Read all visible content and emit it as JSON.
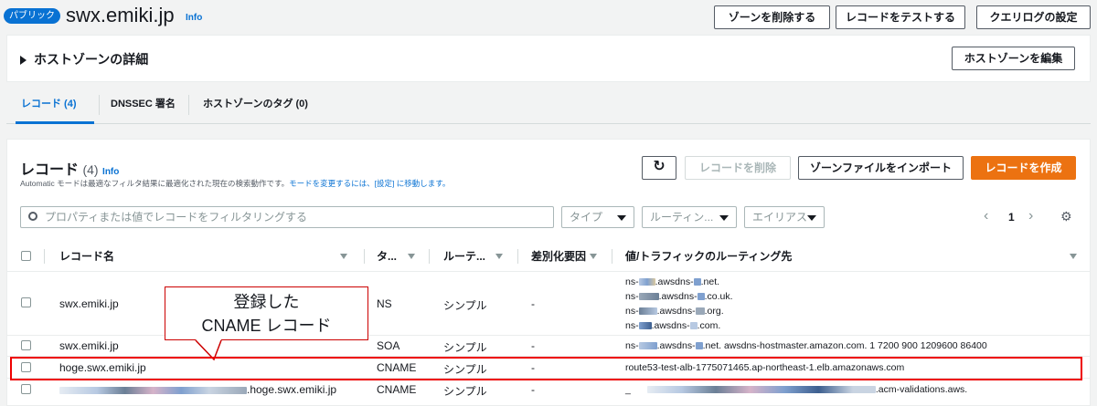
{
  "header": {
    "badge": "パブリック",
    "title": "swx.emiki.jp",
    "info": "Info",
    "buttons": {
      "delete_zone": "ゾーンを削除する",
      "test_record": "レコードをテストする",
      "query_log": "クエリログの設定"
    }
  },
  "details_panel": {
    "title": "ホストゾーンの詳細",
    "edit_button": "ホストゾーンを編集"
  },
  "tabs": [
    {
      "label": "レコード (4)"
    },
    {
      "label": "DNSSEC 署名"
    },
    {
      "label": "ホストゾーンのタグ (0)"
    }
  ],
  "records": {
    "title": "レコード",
    "count": "(4)",
    "info": "Info",
    "desc_text": "Automatic モードは最適なフィルタ結果に最適化された現在の検索動作です。",
    "desc_link": "モードを変更するには、[設定] に移動します。",
    "buttons": {
      "delete": "レコードを削除",
      "import": "ゾーンファイルをインポート",
      "create": "レコードを作成"
    },
    "search_placeholder": "プロパティまたは値でレコードをフィルタリングする",
    "filters": {
      "type": "タイプ",
      "routing": "ルーティン...",
      "alias": "エイリアス"
    },
    "page": "1"
  },
  "table": {
    "headers": {
      "name": "レコード名",
      "type": "タ...",
      "routing": "ルーテ...",
      "diff": "差別化要因",
      "value": "値/トラフィックのルーティング先"
    },
    "rows": [
      {
        "name": "swx.emiki.jp",
        "type": "NS",
        "routing": "シンプル",
        "diff": "-",
        "values": [
          "ns-",
          ".awsdns-",
          ".net.",
          "ns-",
          ".awsdns-",
          ".co.uk.",
          "ns-",
          ".awsdns-",
          ".org.",
          "ns-",
          ".awsdns-",
          ".com."
        ]
      },
      {
        "name": "swx.emiki.jp",
        "type": "SOA",
        "routing": "シンプル",
        "diff": "-",
        "value_prefix": "ns-",
        "value_mid": ".awsdns-",
        "value_rest": ".net. awsdns-hostmaster.amazon.com. 1 7200 900 1209600 86400"
      },
      {
        "name": "hoge.swx.emiki.jp",
        "type": "CNAME",
        "routing": "シンプル",
        "diff": "-",
        "value": "route53-test-alb-1775071465.ap-northeast-1.elb.amazonaws.com"
      },
      {
        "name_suffix": ".hoge.swx.emiki.jp",
        "type": "CNAME",
        "routing": "シンプル",
        "diff": "-",
        "value_prefix": "_",
        "value_suffix": ".acm-validations.aws."
      }
    ]
  },
  "annotation": {
    "line1": "登録した",
    "line2": "CNAME レコード"
  },
  "colors": {
    "accent": "#0972d3",
    "primary_button": "#ec7211",
    "highlight": "#e00000"
  }
}
